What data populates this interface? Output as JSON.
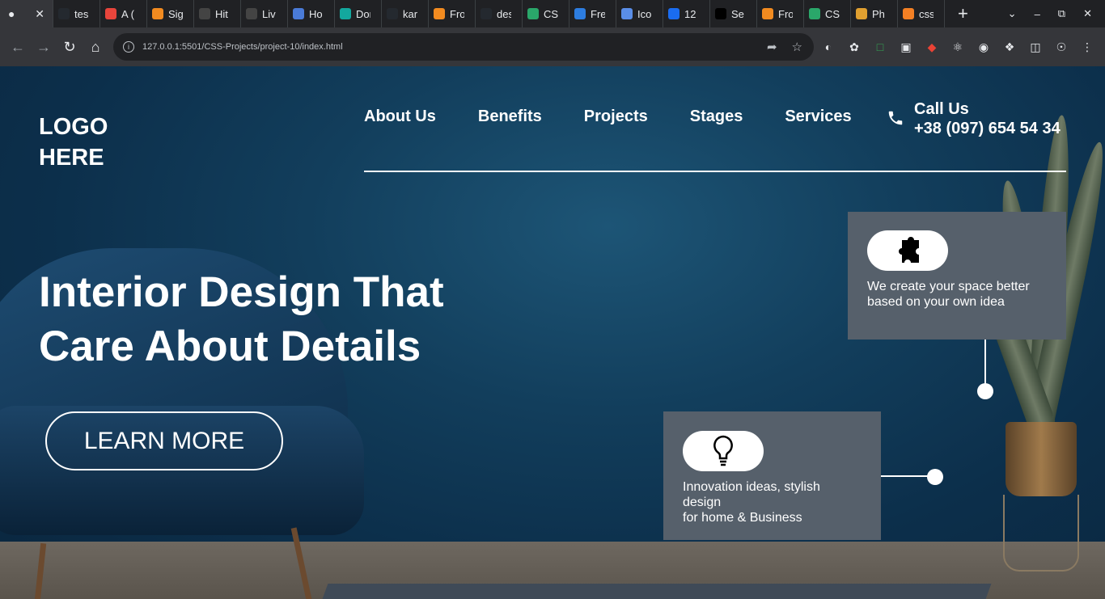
{
  "browser": {
    "tabs": [
      {
        "label": "tes",
        "color": "#24292f"
      },
      {
        "label": "A (",
        "color": "#e8453c"
      },
      {
        "label": "Sig",
        "color": "#f28b20"
      },
      {
        "label": "Hit",
        "color": "#444"
      },
      {
        "label": "Liv",
        "color": "#444"
      },
      {
        "label": "Ho",
        "color": "#4a7bd8"
      },
      {
        "label": "Dor",
        "color": "#13a89e"
      },
      {
        "label": "kar",
        "color": "#24292f"
      },
      {
        "label": "Fro",
        "color": "#f28b20"
      },
      {
        "label": "des",
        "color": "#24292f"
      },
      {
        "label": "CS",
        "color": "#2aa76a"
      },
      {
        "label": "Fre",
        "color": "#2d7de0"
      },
      {
        "label": "Ico",
        "color": "#5a8ee8"
      },
      {
        "label": "12",
        "color": "#1a6cf0"
      },
      {
        "label": "Se",
        "color": "#000"
      },
      {
        "label": "Fro",
        "color": "#f28b20"
      },
      {
        "label": "CS",
        "color": "#2aa76a"
      },
      {
        "label": "Ph",
        "color": "#e0a030"
      },
      {
        "label": "css",
        "color": "#f48024"
      }
    ],
    "url": "127.0.0.1:5501/CSS-Projects/project-10/index.html"
  },
  "site": {
    "logo": [
      "LOGO",
      "HERE"
    ],
    "nav": [
      "About Us",
      "Benefits",
      "Projects",
      "Stages",
      "Services"
    ],
    "phone": {
      "label": "Call Us",
      "number": "+38 (097) 654 54 34"
    },
    "hero": {
      "title_lines": [
        "Interior Design That",
        "Care About Details"
      ],
      "button": "LEARN MORE"
    },
    "card1": {
      "icon": "puzzle-icon",
      "text": "We create your space better based on your own idea"
    },
    "card2": {
      "icon": "lightbulb-icon",
      "text_lines": [
        "Innovation ideas, stylish design",
        "for home & Business"
      ]
    }
  }
}
